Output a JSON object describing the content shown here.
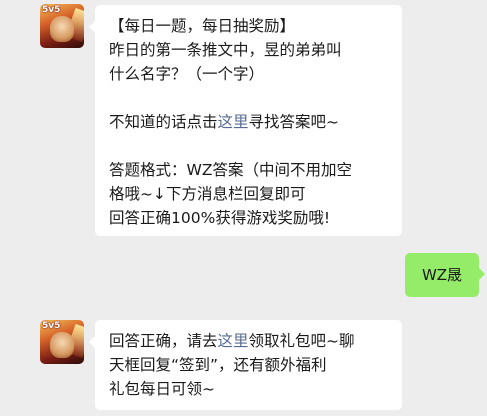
{
  "messages": [
    {
      "sender": "official",
      "lines": [
        "【每日一题，每日抽奖励】",
        "昨日的第一条推文中，昱的弟弟叫",
        "什么名字？（一个字）"
      ],
      "hint_prefix": "不知道的话点击",
      "hint_link": "这里",
      "hint_suffix": "寻找答案吧~",
      "format_lines": [
        "答题格式：WZ答案（中间不用加空",
        "格哦~↓下方消息栏回复即可",
        "回答正确100%获得游戏奖励哦!"
      ]
    },
    {
      "sender": "user",
      "text": "WZ晟"
    },
    {
      "sender": "official",
      "reply_prefix": "回答正确，请去",
      "reply_link": "这里",
      "reply_suffix": "领取礼包吧~聊",
      "reply_lines": [
        "天框回复“签到”，还有额外福利",
        "礼包每日可领~"
      ]
    }
  ],
  "avatar": {
    "badge_text": "5v5"
  }
}
